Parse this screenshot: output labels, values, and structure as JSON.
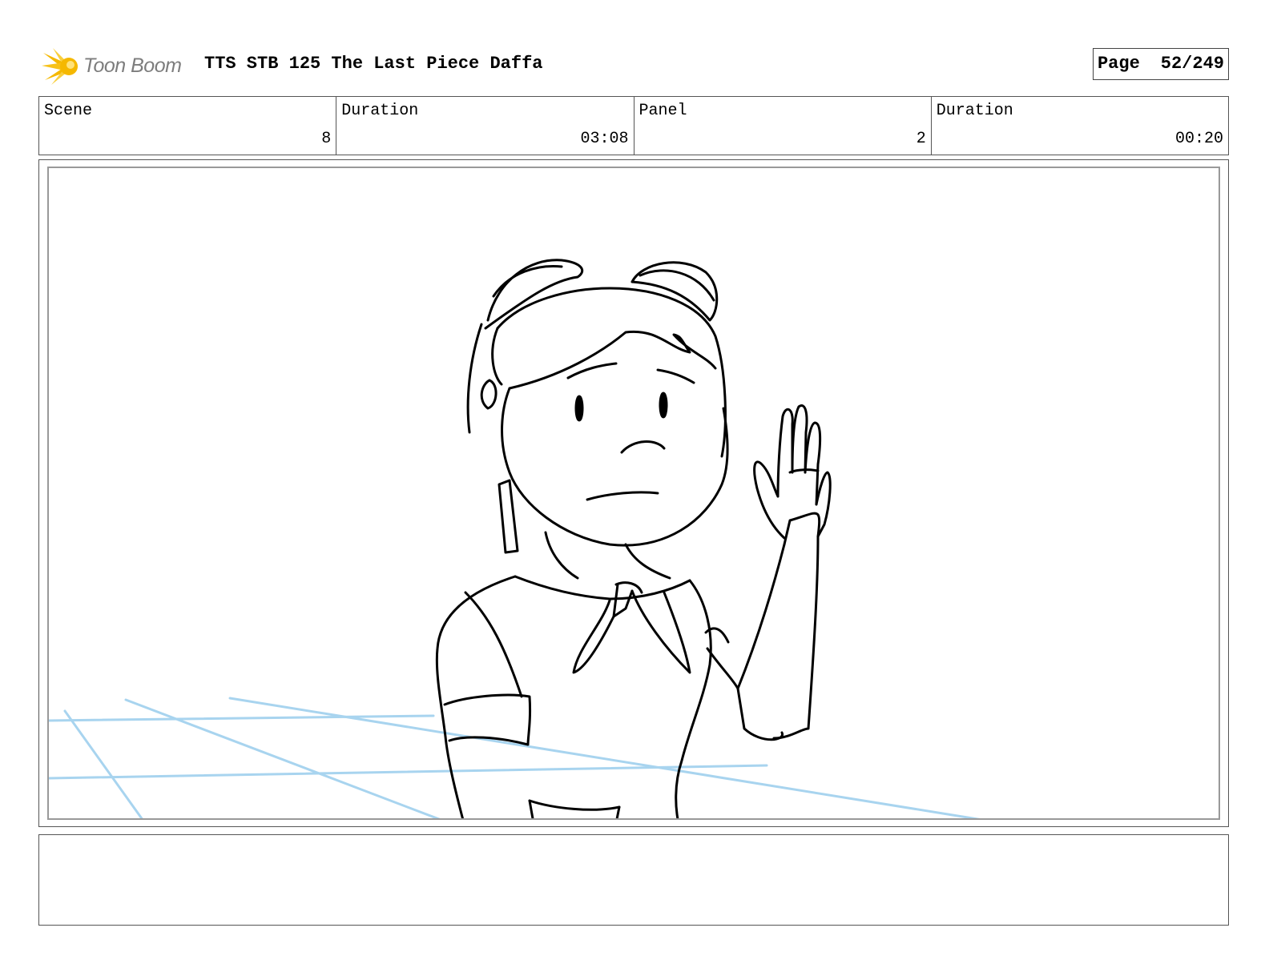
{
  "header": {
    "logo_text": "Toon Boom",
    "title": "TTS STB 125 The Last Piece Daffa",
    "page_label": "Page",
    "page_value": "52/249"
  },
  "info": {
    "scene_label": "Scene",
    "scene_value": "8",
    "scene_duration_label": "Duration",
    "scene_duration_value": "03:08",
    "panel_label": "Panel",
    "panel_value": "2",
    "panel_duration_label": "Duration",
    "panel_duration_value": "00:20"
  },
  "colors": {
    "logo_yellow": "#f5b800",
    "logo_text": "#7d7d7d",
    "guide_lines": "#a8d4ef",
    "ink": "#000000"
  },
  "panel": {
    "drawing_subject": "girl-with-raised-hand-sketch"
  }
}
